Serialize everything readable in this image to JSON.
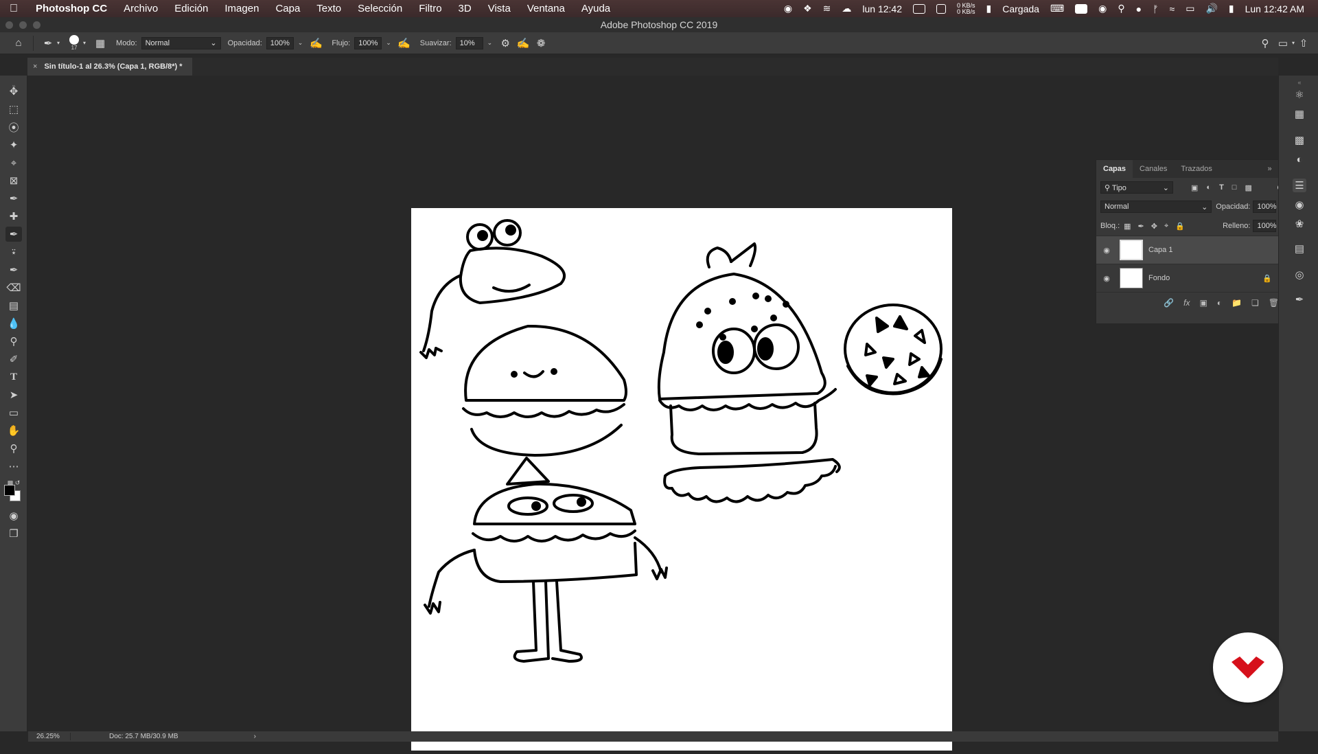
{
  "menubar": {
    "app": "Photoshop CC",
    "items": [
      "Archivo",
      "Edición",
      "Imagen",
      "Capa",
      "Texto",
      "Selección",
      "Filtro",
      "3D",
      "Vista",
      "Ventana",
      "Ayuda"
    ],
    "status_time_short": "lun 12:42",
    "net_up": "0 KB/s",
    "net_down": "0 KB/s",
    "battery_label": "Cargada",
    "clock": "Lun 12:42 AM"
  },
  "window": {
    "title": "Adobe Photoshop CC 2019"
  },
  "options": {
    "brush_size": "17",
    "mode_label": "Modo:",
    "mode_value": "Normal",
    "opacity_label": "Opacidad:",
    "opacity_value": "100%",
    "flow_label": "Flujo:",
    "flow_value": "100%",
    "smooth_label": "Suavizar:",
    "smooth_value": "10%"
  },
  "document": {
    "tab_title": "Sin título-1 al 26.3% (Capa 1, RGB/8*) *"
  },
  "layers_panel": {
    "tabs": [
      "Capas",
      "Canales",
      "Trazados"
    ],
    "filter_value": "Tipo",
    "blend_mode": "Normal",
    "opacity_label": "Opacidad:",
    "opacity_value": "100%",
    "lock_label": "Bloq.:",
    "fill_label": "Relleno:",
    "fill_value": "100%",
    "layers": [
      {
        "name": "Capa 1",
        "selected": true
      },
      {
        "name": "Fondo",
        "selected": false
      }
    ]
  },
  "status": {
    "zoom": "26.25%",
    "doc": "Doc: 25.7 MB/30.9 MB"
  },
  "colors": {
    "accent_watermark": "#d6101b",
    "canvas_bg": "#282828",
    "panel_bg": "#383838"
  }
}
